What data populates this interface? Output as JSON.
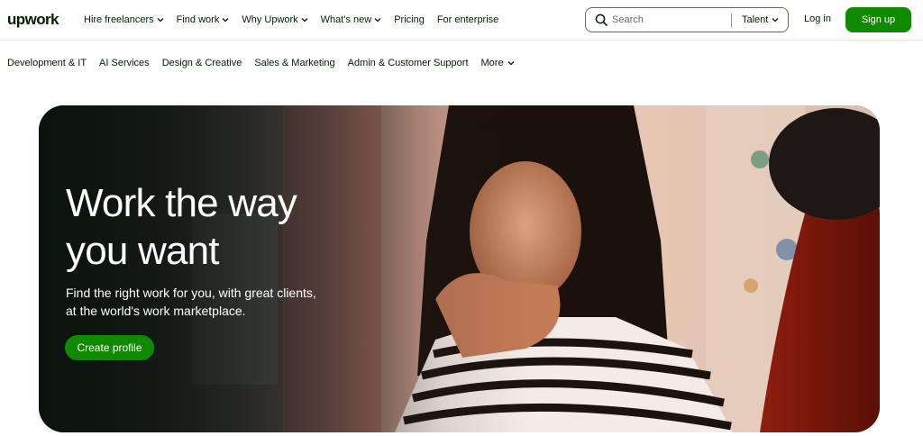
{
  "header": {
    "logo_text": "upwork",
    "brand_color": "#108a00",
    "nav": [
      {
        "label": "Hire freelancers",
        "has_dropdown": true
      },
      {
        "label": "Find work",
        "has_dropdown": true
      },
      {
        "label": "Why Upwork",
        "has_dropdown": true
      },
      {
        "label": "What's new",
        "has_dropdown": true
      },
      {
        "label": "Pricing",
        "has_dropdown": false
      },
      {
        "label": "For enterprise",
        "has_dropdown": false
      }
    ],
    "search": {
      "placeholder": "Search",
      "value": "",
      "scope": "Talent",
      "icon": "search-icon"
    },
    "login_label": "Log in",
    "signup_label": "Sign up"
  },
  "categories": [
    {
      "label": "Development & IT"
    },
    {
      "label": "AI Services"
    },
    {
      "label": "Design & Creative"
    },
    {
      "label": "Sales & Marketing"
    },
    {
      "label": "Admin & Customer Support"
    },
    {
      "label": "More",
      "has_dropdown": true
    }
  ],
  "hero": {
    "title_line1": "Work the way",
    "title_line2": "you want",
    "subtitle_line1": "Find the right work for you, with great clients,",
    "subtitle_line2": "at the world's work marketplace.",
    "cta_label": "Create profile",
    "cta_color": "#108a00"
  }
}
